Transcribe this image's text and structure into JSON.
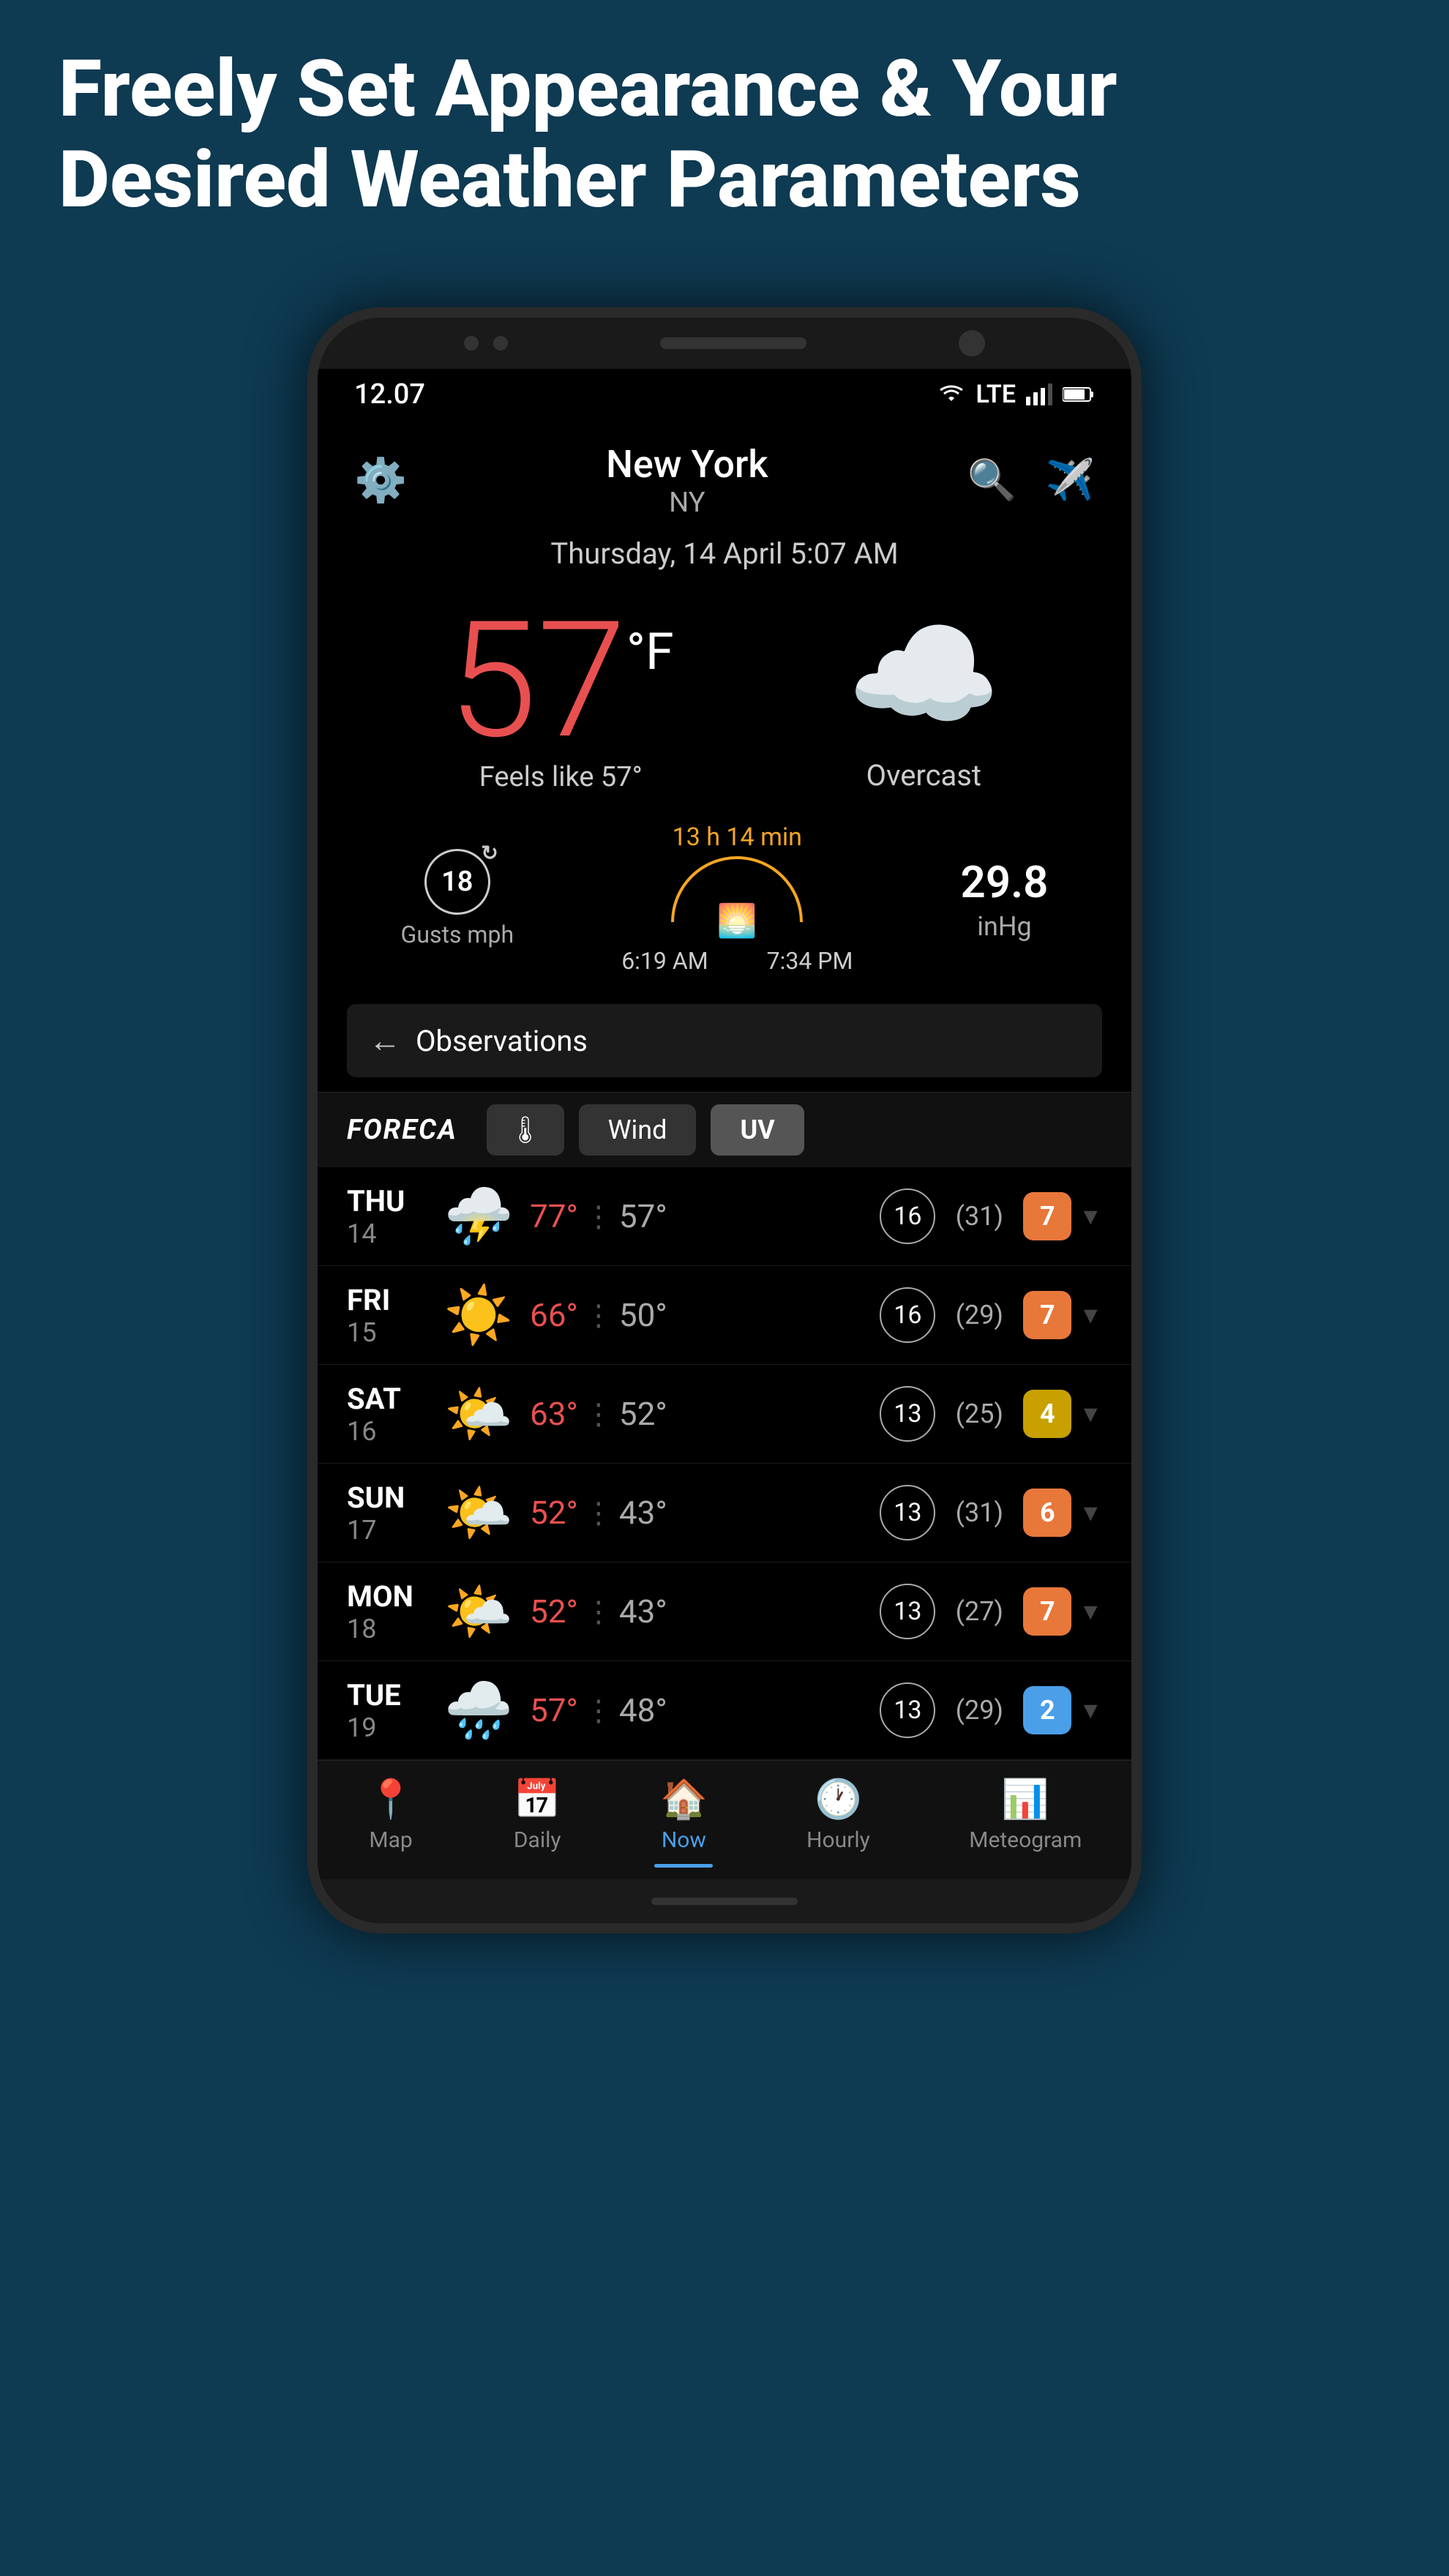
{
  "page": {
    "header_line1": "Freely Set Appearance & Your",
    "header_line2": "Desired Weather Parameters"
  },
  "status_bar": {
    "time": "12.07",
    "lte": "LTE"
  },
  "app_header": {
    "settings_label": "settings",
    "city": "New York",
    "state": "NY",
    "search_label": "search",
    "location_label": "location"
  },
  "current_weather": {
    "date": "Thursday, 14 April 5:07 AM",
    "temperature": "57",
    "unit": "°F",
    "feels_like": "Feels like 57°",
    "condition": "Overcast",
    "cloud_emoji": "🌥️"
  },
  "stats": {
    "gusts_value": "18",
    "gusts_label": "Gusts mph",
    "sunrise_duration": "13 h 14 min",
    "sunrise_time": "6:19 AM",
    "sunset_time": "7:34 PM",
    "pressure_value": "29.8",
    "pressure_label": "inHg"
  },
  "observations_btn": {
    "label": "Observations"
  },
  "foreca": {
    "logo": "FORECA",
    "tabs": [
      {
        "label": "🌡",
        "id": "temp"
      },
      {
        "label": "Wind",
        "id": "wind"
      },
      {
        "label": "UV",
        "id": "uv",
        "active": true
      }
    ]
  },
  "forecast": [
    {
      "day": "THU",
      "date": "14",
      "emoji": "⛈️",
      "high": "77°",
      "low": "57°",
      "wind": "16",
      "wind_parens": "(31)",
      "uv": "7",
      "uv_class": "uv-high"
    },
    {
      "day": "FRI",
      "date": "15",
      "emoji": "☀️",
      "high": "66°",
      "low": "50°",
      "wind": "16",
      "wind_parens": "(29)",
      "uv": "7",
      "uv_class": "uv-high"
    },
    {
      "day": "SAT",
      "date": "16",
      "emoji": "🌤️",
      "high": "63°",
      "low": "52°",
      "wind": "13",
      "wind_parens": "(25)",
      "uv": "4",
      "uv_class": "uv-moderate"
    },
    {
      "day": "SUN",
      "date": "17",
      "emoji": "🌤️",
      "high": "52°",
      "low": "43°",
      "wind": "13",
      "wind_parens": "(31)",
      "uv": "6",
      "uv_class": "uv-high"
    },
    {
      "day": "MON",
      "date": "18",
      "emoji": "🌤️",
      "high": "52°",
      "low": "43°",
      "wind": "13",
      "wind_parens": "(27)",
      "uv": "7",
      "uv_class": "uv-high"
    },
    {
      "day": "TUE",
      "date": "19",
      "emoji": "🌧️",
      "high": "57°",
      "low": "48°",
      "wind": "13",
      "wind_parens": "(29)",
      "uv": "2",
      "uv_class": "uv-low"
    }
  ],
  "bottom_nav": [
    {
      "label": "Map",
      "icon": "📍",
      "id": "map",
      "active": false
    },
    {
      "label": "Daily",
      "icon": "📅",
      "id": "daily",
      "active": false
    },
    {
      "label": "Now",
      "icon": "🏠",
      "id": "now",
      "active": true
    },
    {
      "label": "Hourly",
      "icon": "🕐",
      "id": "hourly",
      "active": false
    },
    {
      "label": "Meteogram",
      "icon": "📊",
      "id": "meteogram",
      "active": false
    }
  ]
}
